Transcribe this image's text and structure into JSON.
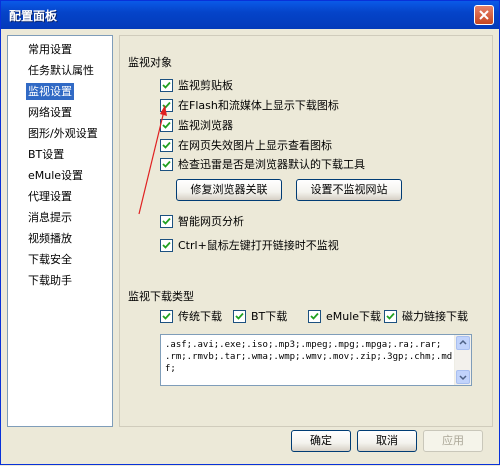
{
  "window": {
    "title": "配置面板"
  },
  "sidebar": {
    "items": [
      {
        "label": "常用设置",
        "selected": false
      },
      {
        "label": "任务默认属性",
        "selected": false
      },
      {
        "label": "监视设置",
        "selected": true
      },
      {
        "label": "网络设置",
        "selected": false
      },
      {
        "label": "图形/外观设置",
        "selected": false
      },
      {
        "label": "BT设置",
        "selected": false
      },
      {
        "label": "eMule设置",
        "selected": false
      },
      {
        "label": "代理设置",
        "selected": false
      },
      {
        "label": "消息提示",
        "selected": false
      },
      {
        "label": "视频播放",
        "selected": false
      },
      {
        "label": "下载安全",
        "selected": false
      },
      {
        "label": "下载助手",
        "selected": false
      }
    ]
  },
  "monitor": {
    "section_label": "监视对象",
    "options": [
      {
        "label": "监视剪贴板",
        "checked": true
      },
      {
        "label": "在Flash和流媒体上显示下载图标",
        "checked": true
      },
      {
        "label": "监视浏览器",
        "checked": true
      },
      {
        "label": "在网页失效图片上显示查看图标",
        "checked": true
      },
      {
        "label": "检查迅雷是否是浏览器默认的下载工具",
        "checked": true
      }
    ],
    "repair_button": "修复浏览器关联",
    "exclude_button": "设置不监视网站",
    "smart_analysis": {
      "label": "智能网页分析",
      "checked": true
    },
    "ctrl_click": {
      "label": "Ctrl+鼠标左键打开链接时不监视",
      "checked": true
    }
  },
  "download_types": {
    "section_label": "监视下载类型",
    "types": [
      {
        "label": "传统下载",
        "checked": true
      },
      {
        "label": "BT下载",
        "checked": true
      },
      {
        "label": "eMule下载",
        "checked": true
      },
      {
        "label": "磁力链接下载",
        "checked": true
      }
    ],
    "extensions": ".asf;.avi;.exe;.iso;.mp3;.mpeg;.mpg;.mpga;.ra;.rar;\n.rm;.rmvb;.tar;.wma;.wmp;.wmv;.mov;.zip;.3gp;.chm;.mdf;"
  },
  "footer": {
    "ok": "确定",
    "cancel": "取消",
    "apply": "应用"
  }
}
